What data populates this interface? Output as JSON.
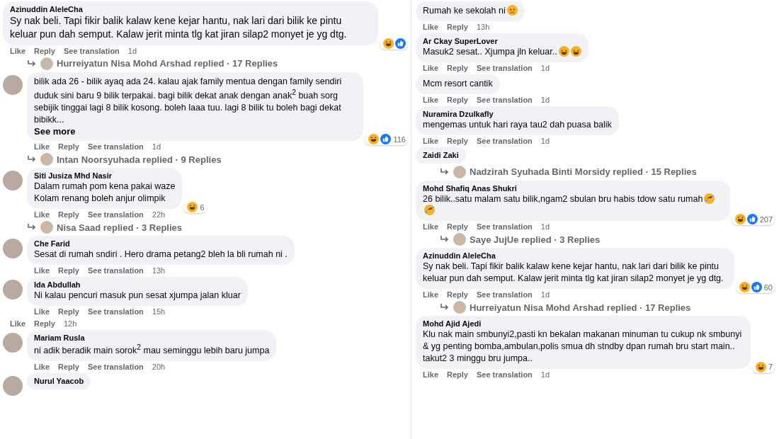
{
  "columns": [
    {
      "items": [
        {
          "kind": "comment",
          "author": "Azinuddin AleleCha",
          "text": "Sy nak beli. Tapi fikir balik kalaw kene kejar hantu, nak lari dari bilik ke pintu keluar pun dah semput. Kalaw jerit minta tlg kat jiran silap2 monyet je yg dtg.",
          "actions": [
            "Like",
            "Reply",
            "See translation"
          ],
          "time": "1d",
          "reactions": [
            {
              "kind": "haha"
            },
            {
              "kind": "like"
            }
          ],
          "avatar": false
        },
        {
          "kind": "replies",
          "text": "Hurreiyatun Nisa Mohd Arshad replied · 17 Replies"
        },
        {
          "kind": "comment",
          "text": "bilik ada 26 - bilik ayaq ada 24. kalau ajak family mentua dengan family sendiri duduk sini baru 9 bilik terpakai. bagi bilik dekat anak dengan anak$^{2}$ buah sorg sebijik tinggai lagi 8 bilik kosong. boleh laaa tuu. lagi 8 bilik tu boleh bagi dekat bibikk...",
          "see_more": "See more",
          "actions": [
            "Like",
            "Reply",
            "See translation"
          ],
          "time": "1d",
          "reactions": [
            {
              "kind": "haha"
            },
            {
              "kind": "like"
            }
          ],
          "reaction_count": "116",
          "avatar": true
        },
        {
          "kind": "replies",
          "text": "Intan Noorsyuhada replied · 9 Replies"
        },
        {
          "kind": "comment",
          "author": "Siti Jusiza Mhd Nasir",
          "text": "Dalam rumah pom kena pakai waze\nKolam renang boleh anjur olimpik",
          "actions": [
            "Like",
            "Reply",
            "See translation"
          ],
          "time": "22h",
          "reactions": [
            {
              "kind": "haha"
            }
          ],
          "reaction_count": "6",
          "avatar": true
        },
        {
          "kind": "replies",
          "text": "Nisa Saad replied · 3 Replies"
        },
        {
          "kind": "comment",
          "author": "Che Farid",
          "text": "Sesat di rumah sndiri . Hero drama petang2 bleh la bli rumah ni .",
          "actions": [
            "Like",
            "Reply",
            "See translation"
          ],
          "time": "13h",
          "avatar": true
        },
        {
          "kind": "comment",
          "author": "Ida Abdullah",
          "text": "Ni kalau pencuri masuk pun sesat xjumpa jalan kluar",
          "actions": [
            "Like",
            "Reply",
            "See translation"
          ],
          "time": "15h",
          "avatar": true
        },
        {
          "kind": "comment",
          "actions": [
            "Like",
            "Reply"
          ],
          "time": "12h",
          "avatar": false
        },
        {
          "kind": "comment",
          "author": "Mariam Rusla",
          "text": "ni adik beradik main sorok$^{2}$ mau seminggu lebih baru jumpa",
          "actions": [
            "Like",
            "Reply",
            "See translation"
          ],
          "time": "20h",
          "avatar": true
        },
        {
          "kind": "comment",
          "author": "Nurul Yaacob",
          "avatar": true
        }
      ]
    },
    {
      "items": [
        {
          "kind": "comment",
          "text": "Rumah ke sekolah ni",
          "emojis": [
            {
              "kind": "sad"
            }
          ],
          "actions": [
            "Like",
            "Reply"
          ],
          "time": "13h",
          "avatar": false
        },
        {
          "kind": "comment",
          "author": "Ar Ckay SuperLover",
          "text": "Masuk2 sesat.. Xjumpa jln keluar..",
          "emojis": [
            {
              "kind": "grin"
            },
            {
              "kind": "grin"
            }
          ],
          "actions": [
            "Like",
            "Reply",
            "See translation"
          ],
          "time": "1d",
          "avatar": false
        },
        {
          "kind": "comment",
          "text": "Mcm resort cantik",
          "actions": [
            "Like",
            "Reply",
            "See translation"
          ],
          "time": "1d",
          "avatar": false
        },
        {
          "kind": "comment",
          "author": "Nuramira Dzulkafly",
          "text": "mengemas untuk hari raya tau2 dah puasa balik",
          "actions": [
            "Like",
            "Reply",
            "See translation"
          ],
          "time": "1d",
          "avatar": false
        },
        {
          "kind": "comment",
          "author": "Zaidi Zaki",
          "avatar": false
        },
        {
          "kind": "replies",
          "text": "Nadzirah Syuhada Binti Morsidy replied · 15 Replies"
        },
        {
          "kind": "comment",
          "author": "Mohd Shafiq Anas Shukri",
          "text": "26 bilik..satu malam satu bilik,ngam2 sbulan bru habis tdow satu rumah",
          "emojis": [
            {
              "kind": "rofl"
            },
            {
              "kind": "rofl"
            }
          ],
          "actions": [
            "Like",
            "Reply",
            "See translation"
          ],
          "time": "1d",
          "reactions": [
            {
              "kind": "haha"
            },
            {
              "kind": "like"
            }
          ],
          "reaction_count": "207",
          "avatar": false
        },
        {
          "kind": "replies",
          "text": "Saye JujUe replied · 3 Replies"
        },
        {
          "kind": "comment",
          "author": "Azinuddin AleleCha",
          "text": "Sy nak beli. Tapi fikir balik kalaw kene kejar hantu, nak lari dari bilik ke pintu keluar pun dah semput. Kalaw jerit minta tlg kat jiran silap2 monyet je yg dtg.",
          "actions": [
            "Like",
            "Reply",
            "See translation"
          ],
          "time": "1d",
          "reactions": [
            {
              "kind": "haha"
            },
            {
              "kind": "like"
            }
          ],
          "reaction_count": "60",
          "avatar": false
        },
        {
          "kind": "replies",
          "text": "Hurreiyatun Nisa Mohd Arshad replied · 17 Replies"
        },
        {
          "kind": "comment",
          "author": "Mohd Ajid Ajedi",
          "text": "Klu nak main smbunyi2,pasti kn bekalan makanan minuman tu cukup nk smbunyi & yg penting bomba,ambulan,polis smua dh stndby dpan rumah bru start main.. takut2 3 minggu bru jumpa..",
          "actions": [
            "Like",
            "Reply",
            "See translation"
          ],
          "time": "1d",
          "reactions": [
            {
              "kind": "haha"
            }
          ],
          "reaction_count": "7",
          "avatar": false
        }
      ]
    }
  ]
}
